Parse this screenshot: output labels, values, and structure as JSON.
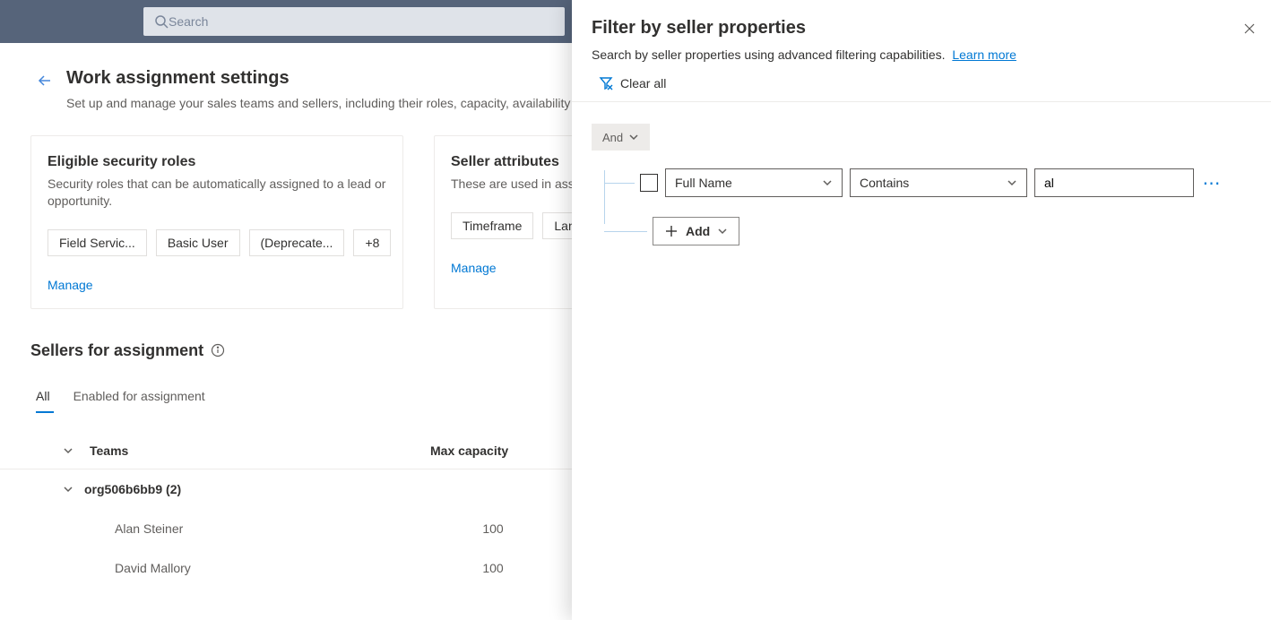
{
  "topbar": {
    "search_placeholder": "Search"
  },
  "page": {
    "title": "Work assignment settings",
    "subtitle": "Set up and manage your sales teams and sellers, including their roles, capacity, availability a"
  },
  "roles_card": {
    "title": "Eligible security roles",
    "subtitle": "Security roles that can be automatically assigned to a lead or opportunity.",
    "chips": [
      "Field Servic...",
      "Basic User",
      "(Deprecate...",
      "+8"
    ],
    "manage": "Manage"
  },
  "attrs_card": {
    "title": "Seller attributes",
    "subtitle": "These are used in assign",
    "chips": [
      "Timeframe",
      "Langua"
    ],
    "manage": "Manage"
  },
  "sellers_section": {
    "title": "Sellers for assignment",
    "tabs": [
      "All",
      "Enabled for assignment"
    ],
    "columns": {
      "teams": "Teams",
      "max": "Max capacity"
    },
    "group": "org506b6bb9 (2)",
    "rows": [
      {
        "name": "Alan Steiner",
        "capacity": "100"
      },
      {
        "name": "David Mallory",
        "capacity": "100"
      }
    ]
  },
  "flyout": {
    "title": "Filter by seller properties",
    "subtitle_text": "Search by seller properties using advanced filtering capabilities.",
    "learn_more": "Learn more",
    "clear_all": "Clear all",
    "and_label": "And",
    "rule": {
      "field": "Full Name",
      "operator": "Contains",
      "value": "al"
    },
    "add_label": "Add"
  }
}
